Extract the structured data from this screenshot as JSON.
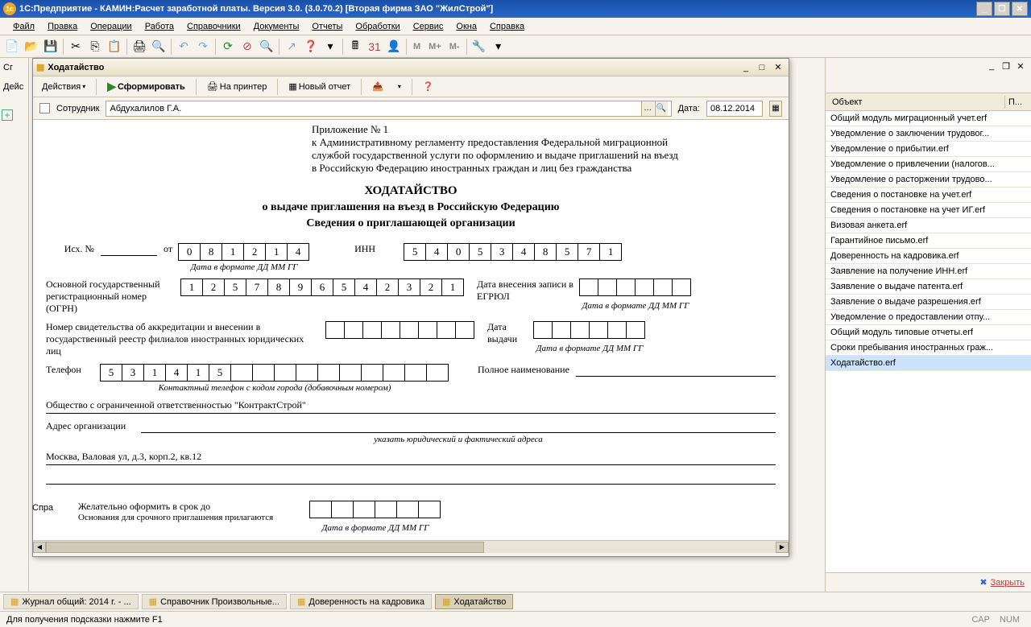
{
  "titlebar": {
    "text": "1С:Предприятие - КАМИН:Расчет заработной платы. Версия 3.0. (3.0.70.2) [Вторая фирма ЗАО \"ЖилСтрой\"]"
  },
  "menubar": {
    "items": [
      "Файл",
      "Правка",
      "Операции",
      "Работа",
      "Справочники",
      "Документы",
      "Отчеты",
      "Обработки",
      "Сервис",
      "Окна",
      "Справка"
    ]
  },
  "left": {
    "tab1": "Сг",
    "actions": "Дейс"
  },
  "dialog": {
    "title": "Ходатайство",
    "toolbar": {
      "actions": "Действия",
      "form": "Сформировать",
      "printer": "На принтер",
      "newreport": "Новый отчет"
    },
    "params": {
      "employee_label": "Сотрудник",
      "employee_value": "Абдухалилов Г.А.",
      "date_label": "Дата:",
      "date_value": "08.12.2014"
    }
  },
  "doc": {
    "h1": "Приложение № 1",
    "h2": "к Административному регламенту предоставления Федеральной миграционной",
    "h3": "службой государственной услуги по оформлению и выдаче приглашений на въезд",
    "h4": "в Российскую Федерацию иностранных граждан и лиц без гражданства",
    "title": "ХОДАТАЙСТВО",
    "sub1": "о выдаче приглашения на въезд в Российскую Федерацию",
    "sub2": "Сведения о приглашающей организации",
    "ish": "Исх. №",
    "ot": "от",
    "date1": [
      "0",
      "8",
      "1",
      "2",
      "1",
      "4"
    ],
    "date_hint": "Дата в формате ДД ММ ГГ",
    "inn_label": "ИНН",
    "inn": [
      "5",
      "4",
      "0",
      "5",
      "3",
      "4",
      "8",
      "5",
      "7",
      "1"
    ],
    "ogrn_label": "Основной государственный регистрационный номер (ОГРН)",
    "ogrn": [
      "1",
      "2",
      "5",
      "7",
      "8",
      "9",
      "6",
      "5",
      "4",
      "2",
      "3",
      "2",
      "1"
    ],
    "egrul_label": "Дата внесения записи в ЕГРЮЛ",
    "accred_label": "Номер свидетельства об аккредитации и внесении в государственный реестр филиалов иностранных юридических лиц",
    "issue_date_label": "Дата выдачи",
    "phone_label": "Телефон",
    "phone": [
      "5",
      "3",
      "1",
      "4",
      "1",
      "5",
      "",
      "",
      "",
      "",
      "",
      "",
      "",
      "",
      "",
      ""
    ],
    "phone_hint": "Контактный телефон с кодом города (добавочным номером)",
    "fullname_label": "Полное наименование",
    "company": "Общество с ограниченной ответственностью \"КонтрактСтрой\"",
    "address_label": "Адрес организации",
    "address_hint": "указать  юридический и фактический адреса",
    "address": "Москва, Валовая ул, д.3, корп.2, кв.12",
    "deadline_label": "Желательно оформить в срок до",
    "reason_label": "Основания для срочного приглашения прилагаются"
  },
  "right": {
    "col1": "Объект",
    "col2": "П...",
    "items": [
      "Общий модуль миграционный учет.erf",
      "Уведомление о заключении трудовог...",
      "Уведомление о прибытии.erf",
      "Уведомление о привлечении (налогов...",
      "Уведомление о расторжении трудово...",
      "Сведения о постановке на учет.erf",
      "Сведения о постановке на учет ИГ.erf",
      "Визовая анкета.erf",
      "Гарантийное письмо.erf",
      "Доверенность на кадровика.erf",
      "Заявление на получение ИНН.erf",
      "Заявление о выдаче патента.erf",
      "Заявление о выдаче разрешения.erf",
      "Уведомление о предоставлении отпу...",
      "Общий модуль типовые отчеты.erf",
      "Сроки пребывания иностранных граж...",
      "Ходатайство.erf"
    ],
    "selected": 16,
    "close": "Закрыть"
  },
  "err": "Спра",
  "taskbar": {
    "items": [
      "Журнал общий: 2014 г. - ...",
      "Справочник Произвольные...",
      "Доверенность на кадровика",
      "Ходатайство"
    ],
    "active": 3
  },
  "statusbar": {
    "hint": "Для получения подсказки нажмите F1",
    "cap": "CAP",
    "num": "NUM"
  }
}
